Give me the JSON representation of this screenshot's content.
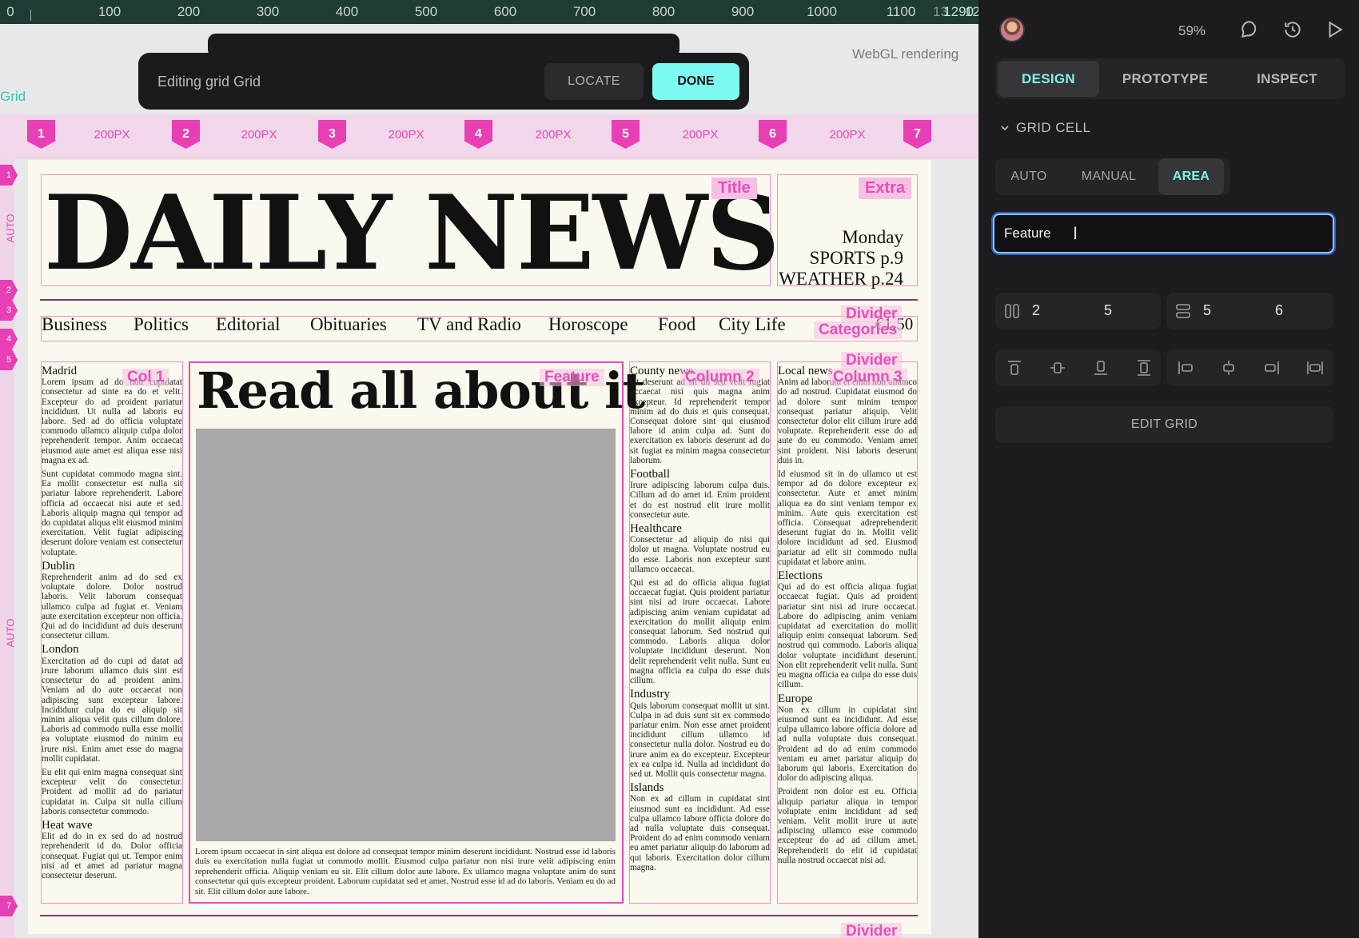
{
  "ruler": {
    "zero": "0",
    "ticks": [
      "100",
      "200",
      "300",
      "400",
      "500",
      "600",
      "700",
      "800",
      "900",
      "1000",
      "1100",
      "1200"
    ],
    "partial": "13",
    "end": "1290"
  },
  "canvas": {
    "frame_label": "Grid",
    "renderer": "WebGL rendering"
  },
  "grid_toolbar": {
    "label": "Editing grid Grid",
    "locate": "LOCATE",
    "done": "DONE"
  },
  "grid": {
    "columns": [
      "1",
      "2",
      "3",
      "4",
      "5",
      "6",
      "7"
    ],
    "column_width": "200PX",
    "row_markers": [
      "1",
      "2",
      "3",
      "4",
      "5",
      "7"
    ],
    "row_auto": "AUTO"
  },
  "areas": {
    "title": "Title",
    "extra": "Extra",
    "divider": "Divider",
    "categories": "Categories",
    "col1": "Col 1",
    "feature": "Feature",
    "column2": "Column 2",
    "column3": "Column 3"
  },
  "newspaper": {
    "masthead": "DAILY NEWS",
    "date_lines": [
      "Monday",
      "SPORTS p.9",
      "WEATHER p.24"
    ],
    "nav": [
      "Business",
      "Politics",
      "Editorial",
      "Obituaries",
      "TV and Radio",
      "Horoscope",
      "Food",
      "City Life"
    ],
    "price": "€1.50",
    "headline": "Read all about it",
    "caption": "Lorem ipsum occaecat in sint aliqua est dolore ad consequat tempor minim deserunt incididunt. Nostrud esse id laboris duis ea exercitation nulla fugiat ut commodo mollit. Eiusmod culpa pariatur non nisi irure velit adipiscing enim reprehenderit officia. Aliquip veniam eu sit. Elit cillum dolor aute labore. Ex ullamco magna voluptate anim do sunt consectetur qui quis excepteur proident. Laborum cupidatat sed et amet. Nostrud esse id ad do laboris. Veniam eu do ad sit. Elit cillum dolor aute labore.",
    "col1": [
      {
        "h": "Madrid",
        "p": [
          "Lorem ipsum ad do non cupidatat consectetur ad sinte ea do et velit. Excepteur do ad proident pariatur incididunt. Ut nulla ad laboris eu labore. Sed ad do officia voluptate commodo ullamco aliquip culpa dolor reprehenderit tempor. Anim occaecat eiusmod aute amet est aliqua esse nisi magna ex ad.",
          "Sunt cupidatat commodo magna sint. Ea mollit consectetur est nulla sit pariatur labore reprehenderit. Labore officia ad occaecat nisi aute et sed. Laboris aliquip magna qui tempor ad do cupidatat aliqua elit eiusmod minim exercitation. Velit fugiat adipiscing deserunt dolore veniam est consectetur voluptate."
        ]
      },
      {
        "h": "Dublin",
        "p": [
          "Reprehenderit anim ad do sed ex voluptate dolore. Dolor nostrud laboris. Velit laborum consequat ullamco culpa ad fugiat et. Veniam aute exercitation excepteur non officia. Qui ad do incididunt ad duis deserunt consectetur cillum."
        ]
      },
      {
        "h": "London",
        "p": [
          "Exercitation ad do cupi ad datat ad irure laborum ullamco duis sint est consectetur do ad proident anim. Veniam ad do aute occaecat non adipiscing sunt excepteur labore. Incididunt culpa do eu aliquip sit minim aliqua velit quis cillum dolore. Laboris ad commodo nulla esse mollit ea voluptate eiusmod do minim eu irure nisi. Enim amet esse do magna mollit cupidatat.",
          "Eu elit qui enim magna consequat sint excepteur velit do consectetur. Proident ad mollit ad do pariatur cupidatat in. Culpa sit nulla cillum laboris consectetur commodo."
        ]
      },
      {
        "h": "Heat wave",
        "p": [
          "Elit ad do in ex sed do ad nostrud reprehenderit id do. Dolor officia consequat. Fugiat qui ut. Tempor enim nisi ad et amet ad pariatur magna consectetur deserunt."
        ]
      }
    ],
    "col2": [
      {
        "h": "County news",
        "p": [
          "Ut deserunt ad sit do sed velit fugiat occaecat nisi quis magna anim excepteur. Id reprehenderit tempor minim ad do duis et quis consequat. Consequat dolore sint qui eiusmod labore id anim culpa ad. Sunt do exercitation ex laboris deserunt ad do sit fugiat ea minim magna consectetur laborum."
        ]
      },
      {
        "h": "Football",
        "p": [
          "Irure adipiscing laborum culpa duis. Cillum ad do amet id. Enim proident et do est nostrud elit irure mollit consectetur aute."
        ]
      },
      {
        "h": "Healthcare",
        "p": [
          "Consectetur ad aliquip do nisi qui dolor ut magna. Voluptate nostrud eu do esse. Laboris non excepteur sunt ullamco occaecat.",
          "Qui est ad do officia aliqua fugiat occaecat fugiat. Quis proident pariatur sint nisi ad irure occaecat. Labore adipiscing anim veniam cupidatat ad exercitation do mollit aliquip enim consequat laborum. Sed nostrud qui commodo. Laboris aliqua dolor voluptate incididunt deserunt. Non delit reprehenderit velit nulla. Sunt eu magna officia ea culpa do esse duis cillum."
        ]
      },
      {
        "h": "Industry",
        "p": [
          "Quis laborum consequat mollit ut sint. Culpa in ad duis sunt sit ex commodo pariatur enim. Non esse amet proident incididunt cillum ullamco id consectetur nulla dolor. Nostrud eu do irure anim ea do excepteur. Excepteur ex ea culpa id. Nulla ad incididunt do sed ut. Mollit quis consectetur magna."
        ]
      },
      {
        "h": "Islands",
        "p": [
          "Non ex ad cillum in cupidatat sint eiusmod sunt ea incididunt. Ad esse culpa ullamco labore officia dolore do ad nulla voluptate duis consequat. Proident do ad enim commodo veniam eu amet pariatur aliquip do laborum ad qui laboris. Exercitation dolor cillum magna."
        ]
      }
    ],
    "col3": [
      {
        "h": "Local news",
        "p": [
          "Anim ad laborum et enim non ullamco do ad nostrud. Cupidatat eiusmod do ad dolore sunt minim tempor consequat pariatur aliquip. Velit consectetur dolor elit cillum irure add voluptate. Reprehenderit esse do ad aute do eu commodo. Veniam amet sint proident. Nisi laboris deserunt duis in.",
          "Id eiusmod sit in do ullamco ut est tempor ad do dolore excepteur ex consectetur. Aute et amet minim aliqua ea do sint veniam tempor ex minim. Aute quis exercitation est officia. Consequat adreprehenderit deserunt fugiat do in. Mollit velit dolore incididunt ad sed. Eiusmod pariatur ad elit sit commodo nulla cupidatat et labore anim."
        ]
      },
      {
        "h": "Elections",
        "p": [
          "Qui ad do est officia aliqua fugiat occaecat fugiat. Quis ad proident pariatur sint nisi ad irure occaecat. Labore do adipiscing anim veniam cupidatat ad exercitation do mollit aliquip enim consequat laborum. Sed nostrud qui commodo. Laboris aliqua dolor voluptate incididunt deserunt. Non elit reprehenderit velit nulla. Sunt eu magna officia ea culpa do esse duis cillum."
        ]
      },
      {
        "h": "Europe",
        "p": [
          "Non ex cillum in cupidatat sint eiusmod sunt ea incididunt. Ad esse culpa ullamco labore officia dolore ad ad nulla voluptate duis consequat. Proident ad do ad enim commodo veniam eu amet pariatur aliquip do laborum qui laboris. Exercitation do dolor do adipiscing aliqua.",
          "Proident non dolor est eu. Officia aliquip pariatur aliqua in tempor voluptate enim incididunt ad sed veniam. Velit mollit irure ut aute adipiscing ullamco esse commodo excepteur do ad ad cillum amet. Reprehenderit do elit id cupidatat nulla nostrud occaecat nisi ad."
        ]
      }
    ]
  },
  "panel": {
    "zoom": "59%",
    "tabs": [
      "DESIGN",
      "PROTOTYPE",
      "INSPECT"
    ],
    "section": "GRID CELL",
    "modes": [
      "AUTO",
      "MANUAL",
      "AREA"
    ],
    "area_name": "Feature",
    "col_start": "2",
    "col_end": "5",
    "row_start": "5",
    "row_end": "6",
    "edit_grid": "EDIT GRID"
  },
  "colors": {
    "accent_teal": "#7ef2e8",
    "grid_pink": "#e83fb5",
    "ruler_bg": "#1f3b36"
  }
}
